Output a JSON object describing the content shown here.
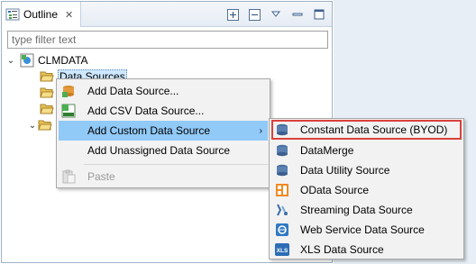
{
  "view": {
    "tab_title": "Outline",
    "tab_close": "✕",
    "filter_placeholder": "type filter text"
  },
  "tree": {
    "root_label": "CLMDATA",
    "selected_label": "Data Sources"
  },
  "context_menu": {
    "items": [
      {
        "label": "Add Data Source..."
      },
      {
        "label": "Add CSV Data Source..."
      },
      {
        "label": "Add Custom Data Source",
        "submenu_arrow": "›"
      },
      {
        "label": "Add Unassigned Data Source"
      },
      {
        "label": "Paste"
      }
    ]
  },
  "submenu": {
    "items": [
      {
        "label": "Constant Data Source (BYOD)"
      },
      {
        "label": "DataMerge"
      },
      {
        "label": "Data Utility Source"
      },
      {
        "label": "OData Source"
      },
      {
        "label": "Streaming Data Source"
      },
      {
        "label": "Web Service Data Source"
      },
      {
        "label": "XLS Data Source",
        "icon_text": "XLS"
      }
    ]
  },
  "colors": {
    "highlight": "#91c9f7",
    "outline_red": "#d9413c",
    "menu_bg": "#f2f2f2"
  }
}
